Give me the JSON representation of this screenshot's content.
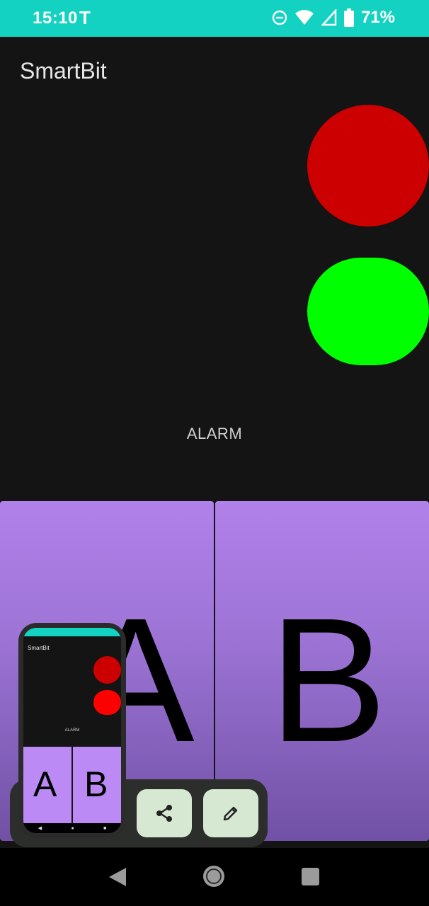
{
  "status_bar": {
    "time": "15:10",
    "notification_glyph": "T",
    "battery_percent": "71%",
    "icons": [
      "do-not-disturb-icon",
      "wifi-icon",
      "cell-signal-icon",
      "battery-icon"
    ]
  },
  "app": {
    "title": "SmartBit",
    "indicator_colors": {
      "top": "#cc0000",
      "bottom": "#00ff00"
    },
    "alarm_label": "ALARM",
    "buttons": [
      {
        "label": "A"
      },
      {
        "label": "B"
      }
    ],
    "pad_color": "#b181ea"
  },
  "screenshot_preview": {
    "title": "SmartBit",
    "alarm_label": "ALARM",
    "buttons": [
      "A",
      "B"
    ],
    "actions": [
      "share-icon",
      "edit-icon"
    ]
  },
  "nav_bar": {
    "buttons": [
      "back",
      "home",
      "recents"
    ]
  },
  "colors": {
    "status_bar": "#14d2c2",
    "background": "#141414",
    "action_button_bg": "#d6e8d2",
    "share_bar_bg": "#2c2e2b"
  }
}
